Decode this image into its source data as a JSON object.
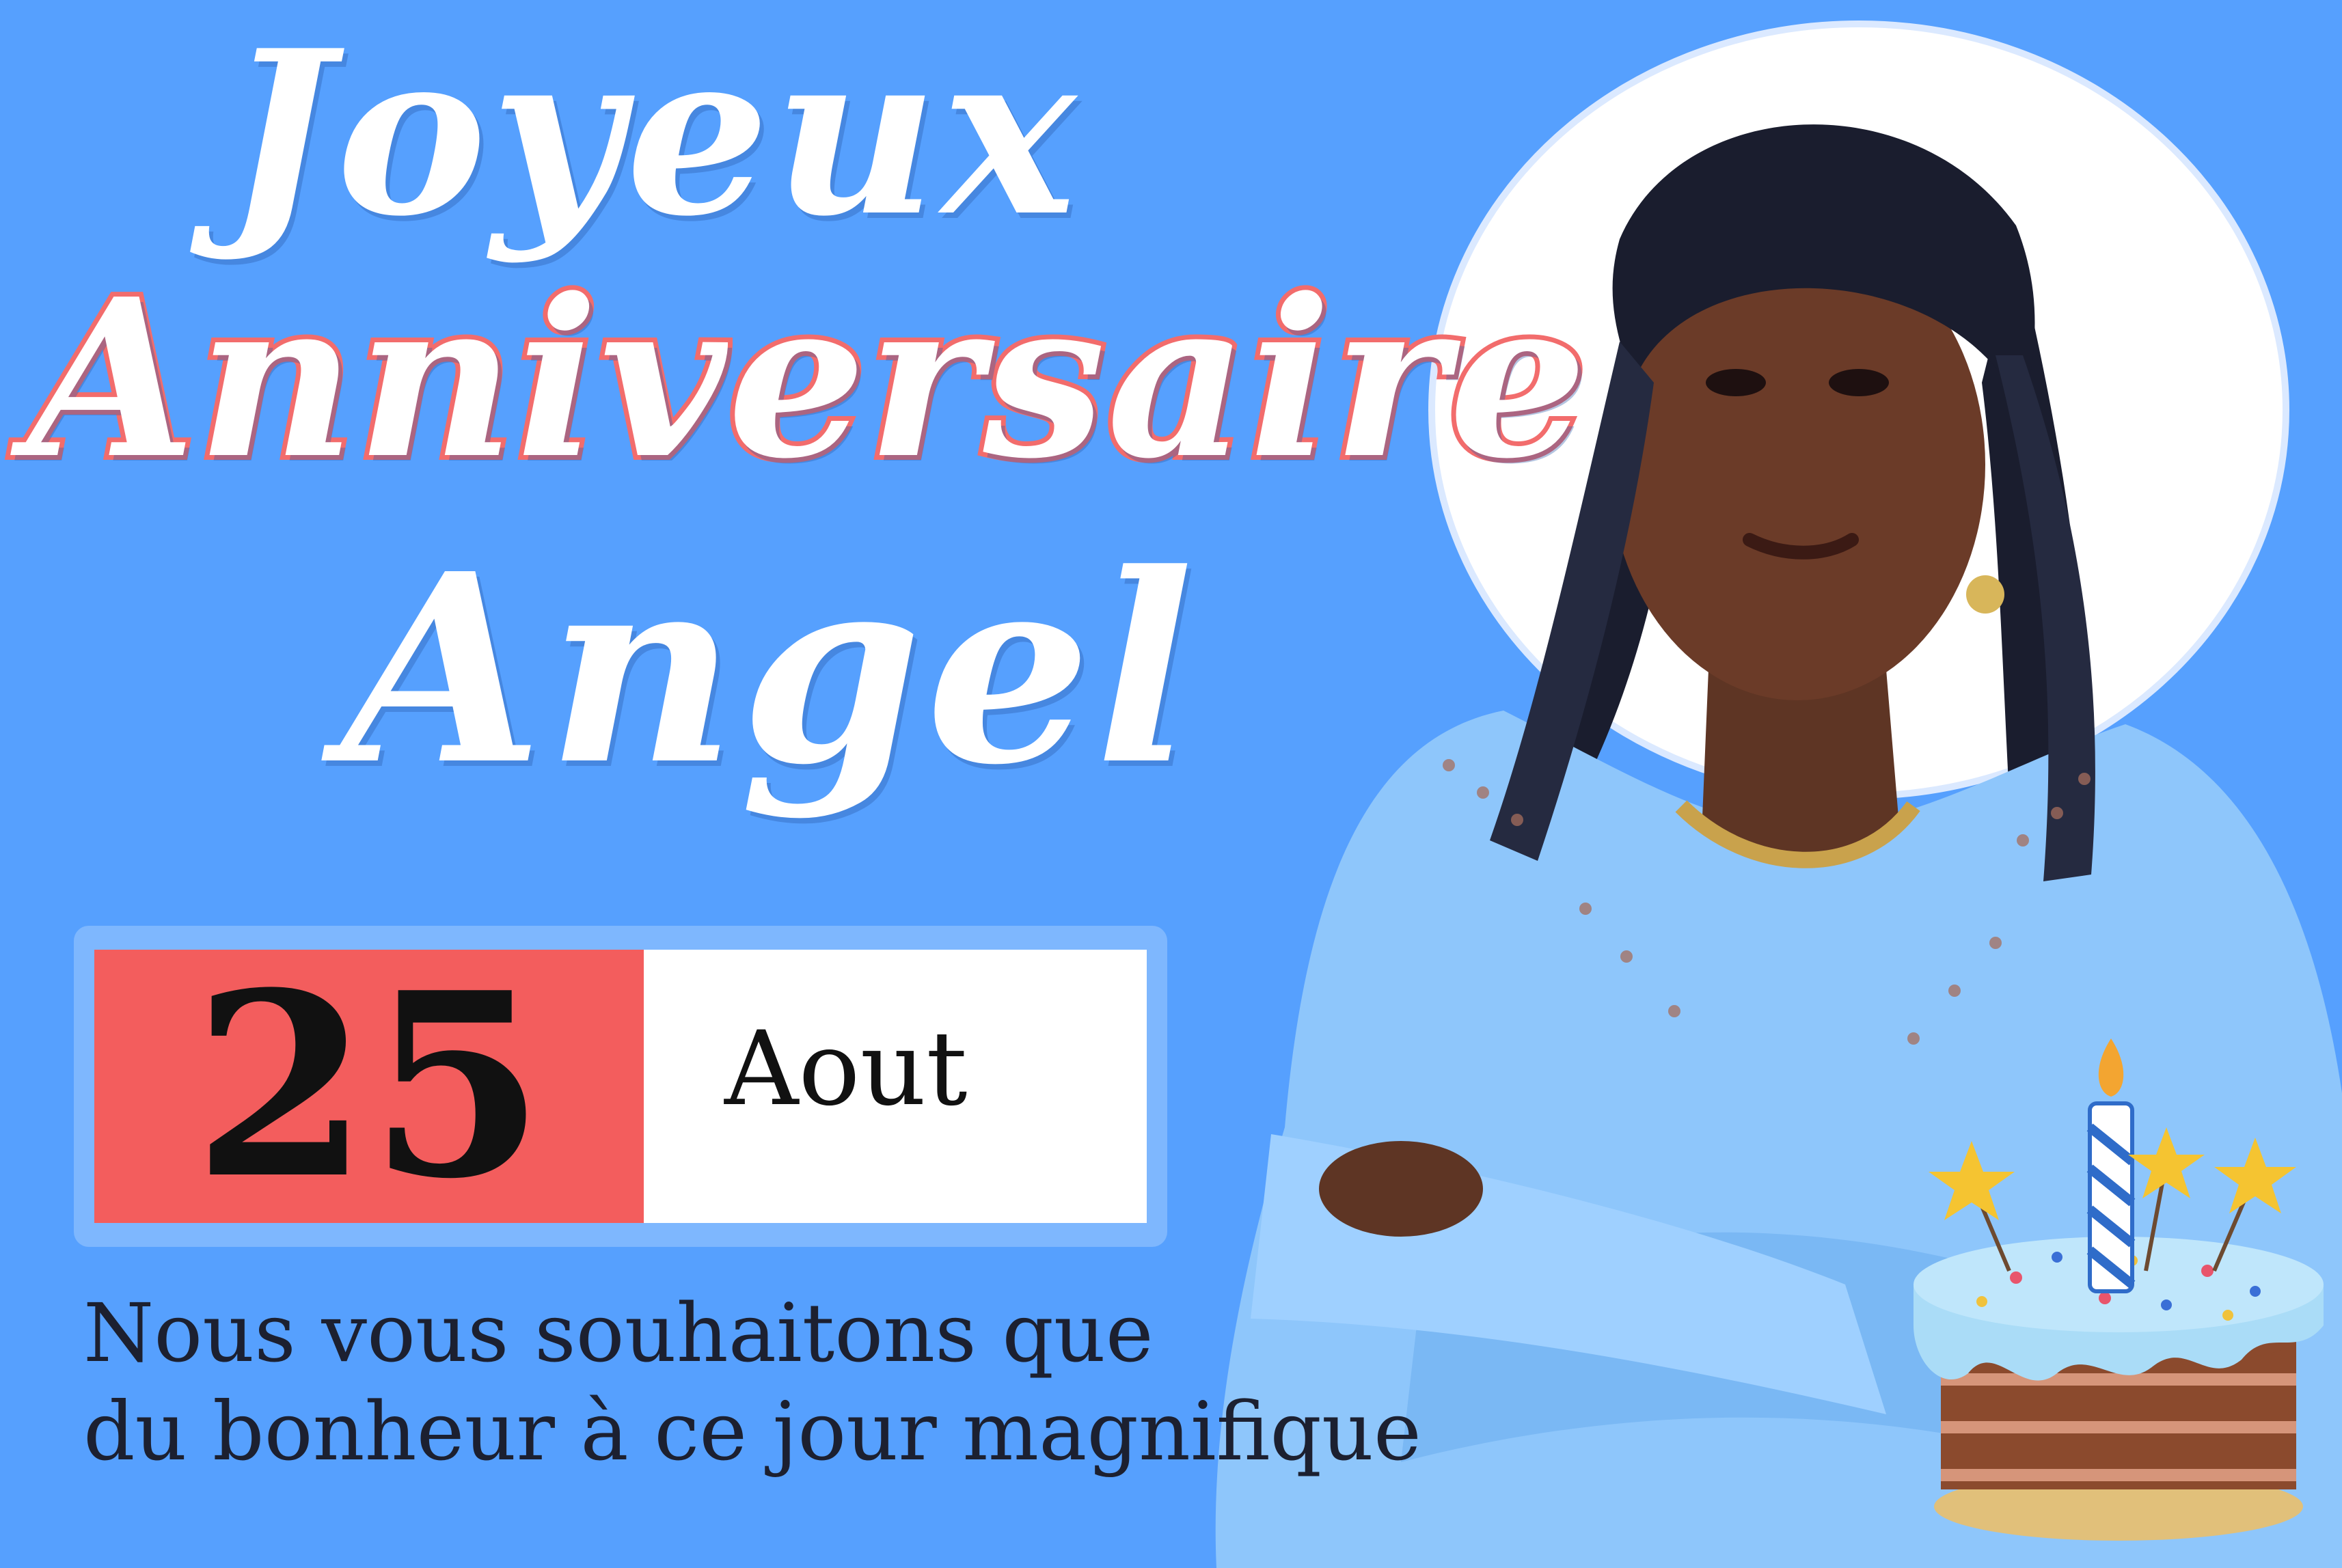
{
  "card": {
    "title_line1": "Joyeux",
    "title_line2": "Anniversaire",
    "name": "Angel",
    "date_day": "25",
    "date_month": "Aout",
    "wish_line1": "Nous vous souhaitons que",
    "wish_line2": "du bonheur à ce jour magnifique"
  },
  "colors": {
    "background": "#56a0fe",
    "accent_red": "#f35d5d",
    "title_white": "#ffffff",
    "halo": "#ffffff",
    "blouse": "#8ec6fb"
  },
  "images": {
    "portrait": "woman-with-braids-portrait",
    "cake": "birthday-cake-icon"
  }
}
